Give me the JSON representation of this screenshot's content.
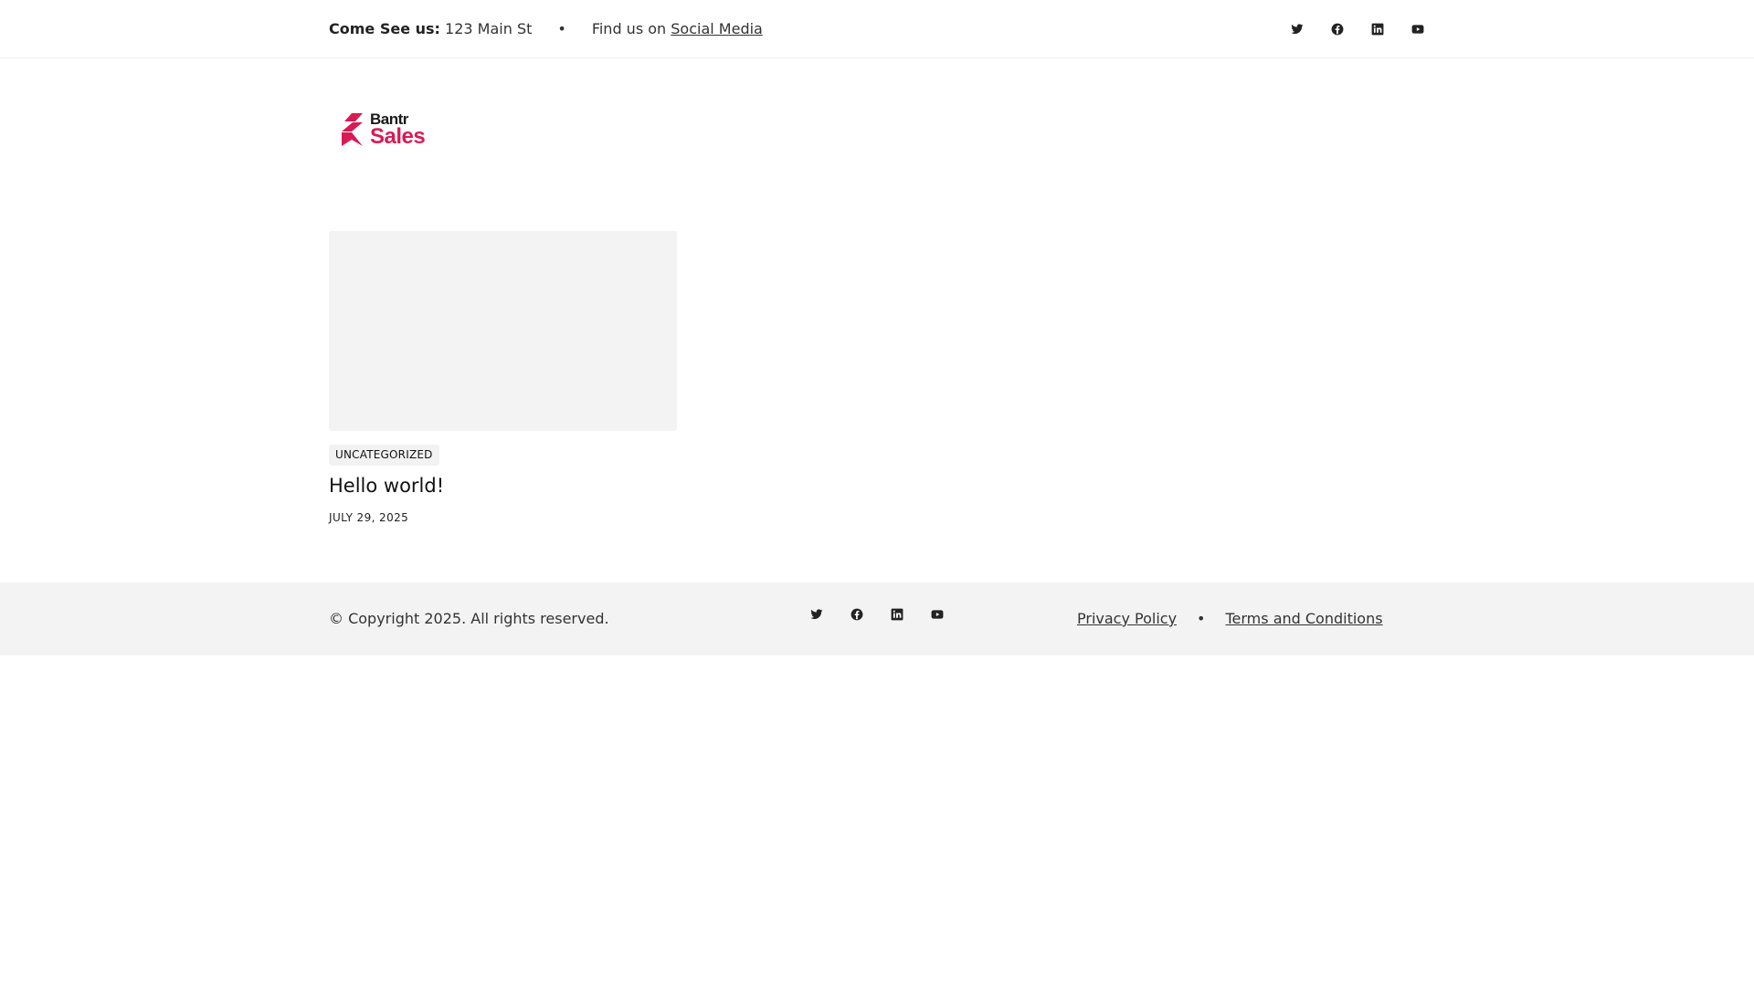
{
  "topbar": {
    "address_label": "Come See us:",
    "address_value": "123 Main St",
    "separator": "•",
    "social_prefix": "Find us on",
    "social_link": "Social Media"
  },
  "social_icons": [
    "twitter-icon",
    "facebook-icon",
    "linkedin-icon",
    "youtube-icon"
  ],
  "logo": {
    "line1": "Bantr",
    "line2": "Sales",
    "brand_color": "#d81b55"
  },
  "post": {
    "category": "UNCATEGORIZED",
    "title": "Hello world!",
    "date": "JULY 29, 2025"
  },
  "footer": {
    "copyright": "© Copyright 2025. All rights reserved.",
    "privacy": "Privacy Policy",
    "separator": "•",
    "terms": "Terms and Conditions"
  }
}
